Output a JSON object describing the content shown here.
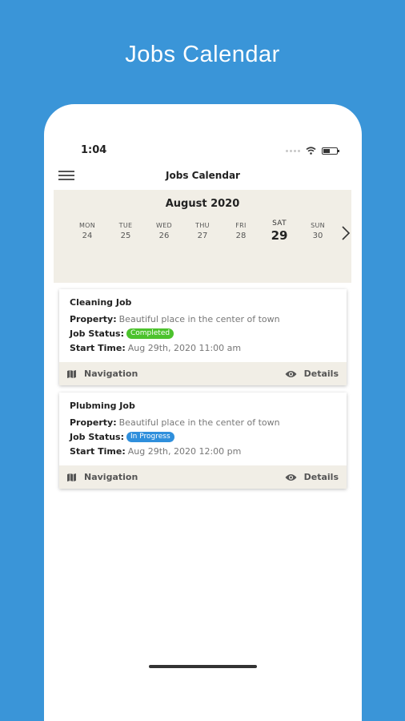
{
  "promo": {
    "title": "Jobs Calendar"
  },
  "status_bar": {
    "time": "1:04"
  },
  "header": {
    "title": "Jobs Calendar"
  },
  "calendar": {
    "month": "August 2020",
    "days": [
      {
        "name": "MON",
        "num": "24"
      },
      {
        "name": "TUE",
        "num": "25"
      },
      {
        "name": "WED",
        "num": "26"
      },
      {
        "name": "THU",
        "num": "27"
      },
      {
        "name": "FRI",
        "num": "28"
      },
      {
        "name": "SAT",
        "num": "29",
        "selected": true
      },
      {
        "name": "SUN",
        "num": "30"
      }
    ]
  },
  "labels": {
    "property": "Property:",
    "job_status": "Job Status:",
    "start_time": "Start Time:",
    "navigation": "Navigation",
    "details": "Details"
  },
  "jobs": [
    {
      "title": "Cleaning Job",
      "property": "Beautiful place in the center of town",
      "status": "Completed",
      "status_color": "#4cc22d",
      "start_time": "Aug 29th, 2020 11:00 am"
    },
    {
      "title": "Plubming Job",
      "property": "Beautiful place in the center of town",
      "status": "In Progress",
      "status_color": "#2f8fdc",
      "start_time": "Aug 29th, 2020 12:00 pm"
    }
  ],
  "colors": {
    "background": "#3a95d8",
    "calendar_bg": "#f1eee6"
  }
}
